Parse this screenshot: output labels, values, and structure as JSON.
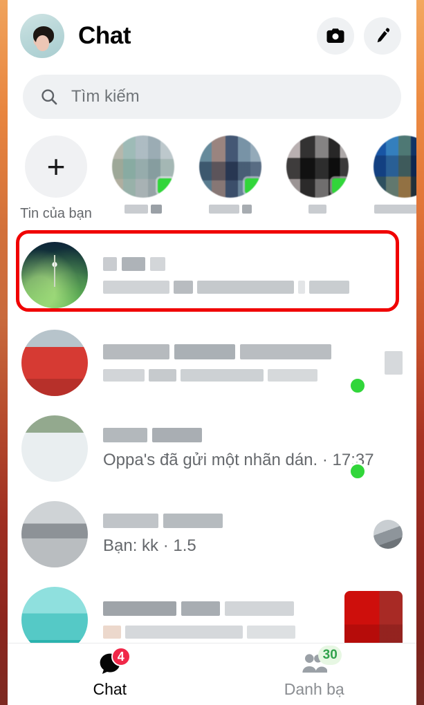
{
  "header": {
    "title": "Chat",
    "avatar_name": "profile-avatar",
    "camera_icon": "camera-icon",
    "compose_icon": "pencil-icon"
  },
  "search": {
    "placeholder": "Tìm kiếm",
    "icon": "search-icon"
  },
  "stories": {
    "add_label": "Tin của bạn",
    "add_icon": "plus-icon",
    "items": [
      {
        "name": "story-1",
        "online": true
      },
      {
        "name": "story-2",
        "online": true
      },
      {
        "name": "story-3",
        "online": true
      },
      {
        "name": "story-4",
        "online": false
      }
    ]
  },
  "chats": [
    {
      "name": "",
      "preview": "",
      "blurred_name": true,
      "blurred_preview": true,
      "online": false,
      "highlighted": true,
      "avatar": "av-flower",
      "thumb": null
    },
    {
      "name": "",
      "preview": "",
      "blurred_name": true,
      "blurred_preview": true,
      "online": true,
      "highlighted": false,
      "avatar": "av-man",
      "thumb": "blur"
    },
    {
      "name": "",
      "preview": "Oppa's đã gửi một nhãn dán. · 17:37",
      "blurred_name": true,
      "blurred_preview": false,
      "online": true,
      "highlighted": false,
      "avatar": "av-white",
      "thumb": null
    },
    {
      "name": "",
      "preview": "Bạn: kk · 1.5",
      "blurred_name": true,
      "blurred_preview": false,
      "online": false,
      "highlighted": false,
      "avatar": "av-street",
      "thumb": "round"
    },
    {
      "name": "",
      "preview": "",
      "blurred_name": true,
      "blurred_preview": true,
      "online": false,
      "highlighted": false,
      "avatar": "av-teal",
      "thumb": "red-square"
    }
  ],
  "bottom_nav": {
    "items": [
      {
        "label": "Chat",
        "icon": "chat-bubble-icon",
        "badge": "4",
        "badge_color": "#f02849",
        "active": true
      },
      {
        "label": "Danh bạ",
        "icon": "people-icon",
        "badge": "30",
        "badge_color": "#31a24c",
        "active": false
      }
    ]
  },
  "colors": {
    "accent_red": "#f02849",
    "online_green": "#31d63a",
    "highlight_border": "#f00000",
    "surface": "#eff1f3"
  }
}
